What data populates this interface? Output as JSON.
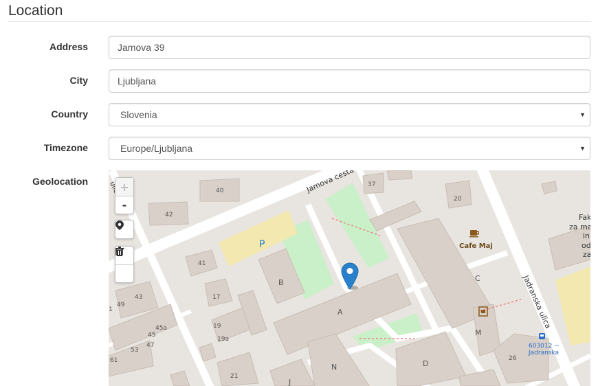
{
  "section": {
    "title": "Location"
  },
  "form": {
    "address": {
      "label": "Address",
      "value": "Jamova 39"
    },
    "city": {
      "label": "City",
      "value": "Ljubljana"
    },
    "country": {
      "label": "Country",
      "value": "Slovenia"
    },
    "timezone": {
      "label": "Timezone",
      "value": "Europe/Ljubljana"
    },
    "geolocation": {
      "label": "Geolocation"
    }
  },
  "map": {
    "controls": {
      "zoom_in": "+",
      "zoom_out": "-",
      "locate_icon": "map-marker-icon",
      "edit_icon": "edit-icon",
      "delete_icon": "trash-icon"
    },
    "streets": {
      "jamova": "Jamova cesta",
      "jadranska": "Jadranska ulica",
      "left": "ulica"
    },
    "labels": {
      "parking": "P",
      "cafe": "Cafe Maj",
      "stop_line1": "603012 ~",
      "stop_line2": "Jadranska",
      "building_b": "B",
      "building_a": "A",
      "building_c": "C",
      "building_d": "D",
      "building_m": "M",
      "building_n": "N",
      "building_j": "J",
      "n40": "40",
      "n42": "42",
      "n41": "41",
      "n37": "37",
      "n20": "20",
      "n17": "17",
      "n19": "19",
      "n19a": "19a",
      "n21": "21",
      "n49": "49",
      "n43": "43",
      "n45a": "45a",
      "n45": "45",
      "n47": "47",
      "n53": "53",
      "n61": "61",
      "n26": "26",
      "n1": "1",
      "fak": "Fak",
      "zama": "za ma",
      "in": "in",
      "od": "od",
      "za": "za"
    },
    "colors": {
      "background": "#e8e4df",
      "building": "#d9d0c9",
      "road": "#ffffff",
      "green": "#c9f0c8",
      "parking": "#f3e9b0",
      "marker": "#2a81cb"
    }
  }
}
